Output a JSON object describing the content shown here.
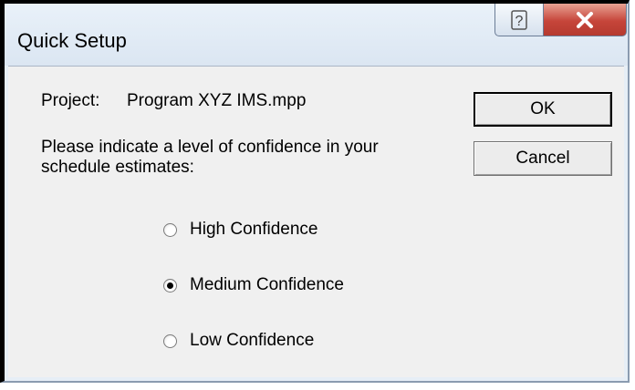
{
  "window": {
    "title": "Quick Setup",
    "help_glyph": "?",
    "close_glyph": "X"
  },
  "project": {
    "label": "Project:",
    "value": "Program XYZ IMS.mpp"
  },
  "prompt": {
    "line1": "Please indicate a level of confidence in your",
    "line2": "schedule estimates:"
  },
  "buttons": {
    "ok": "OK",
    "cancel": "Cancel"
  },
  "confidence_options": [
    {
      "label": "High Confidence",
      "checked": false
    },
    {
      "label": "Medium Confidence",
      "checked": true
    },
    {
      "label": "Low Confidence",
      "checked": false
    }
  ],
  "colors": {
    "close_button": "#c6453a",
    "client_background": "#f0f0f0"
  }
}
